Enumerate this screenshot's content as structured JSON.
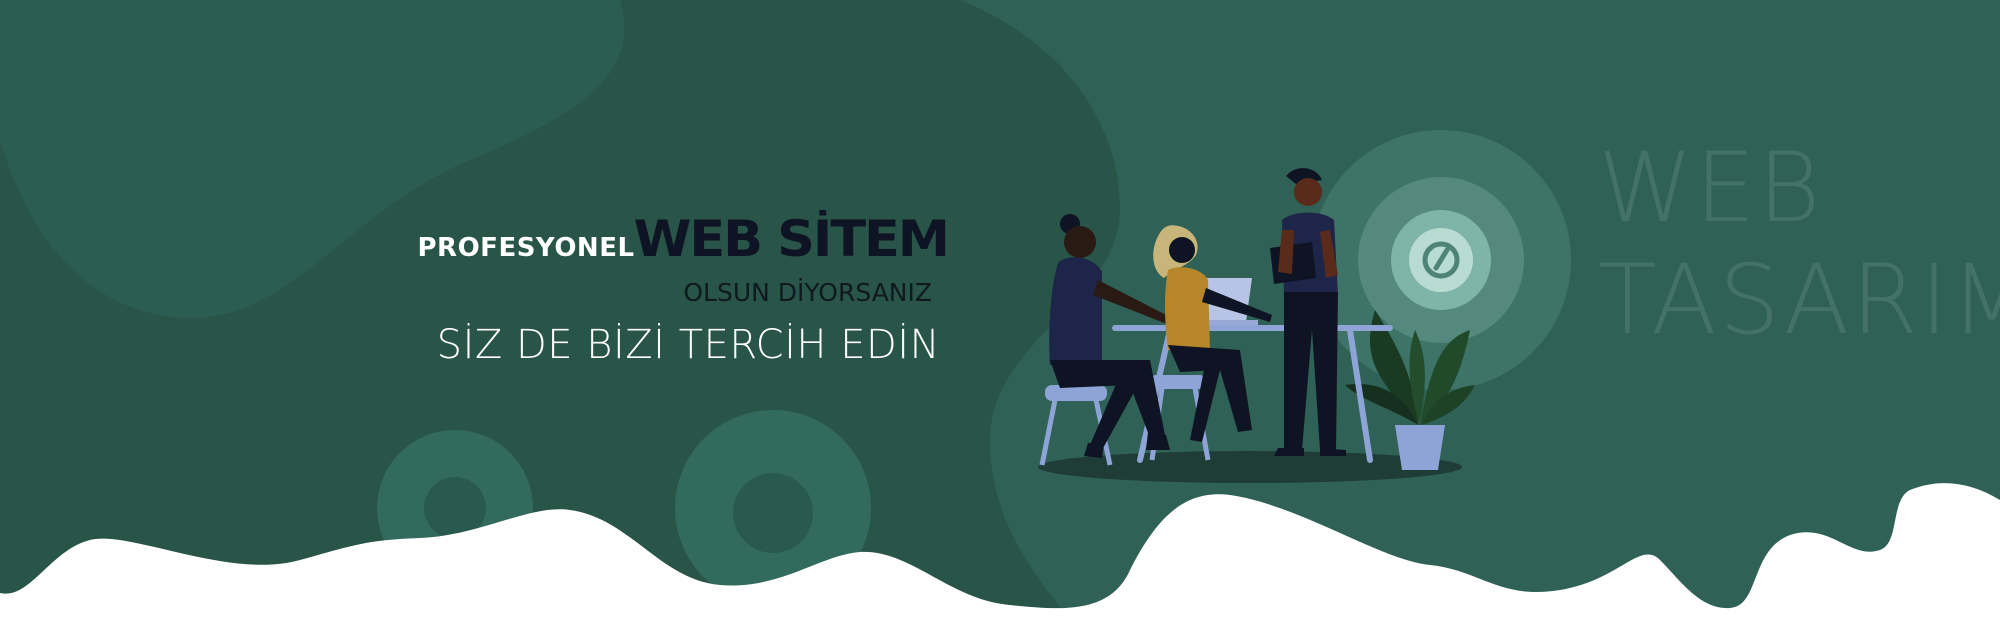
{
  "hero": {
    "tagline_small": "PROFESYONEL",
    "tagline_big": "WEB SİTEM",
    "subline": "OLSUN DİYORSANIZ",
    "cta_line": "SİZ DE BİZİ TERCİH EDİN"
  },
  "watermark": {
    "line1": "WEB",
    "line2": "TASARIM"
  },
  "colors": {
    "background": "#2f6156",
    "blob_dark": "#285548",
    "accent_circle": "#7fb5a8",
    "wave": "#ffffff",
    "headline_dark": "#0e1424"
  },
  "icons": {
    "emblem": "link-icon"
  }
}
